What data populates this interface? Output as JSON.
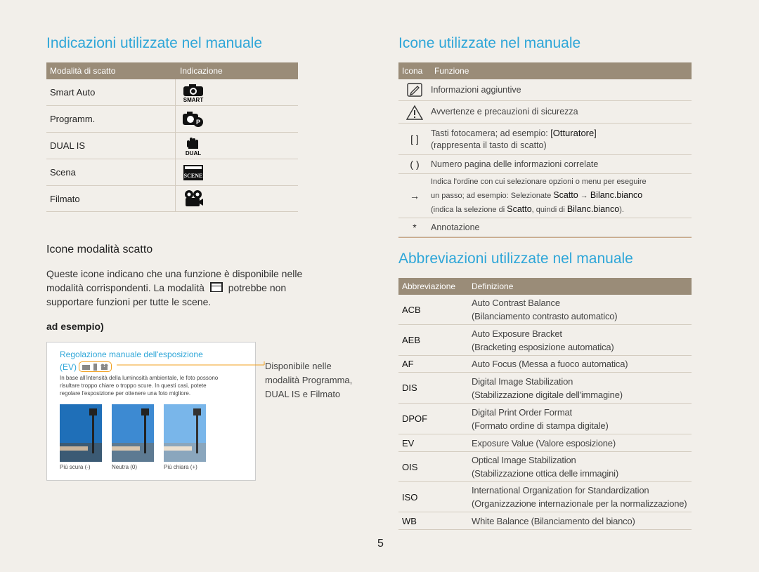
{
  "left": {
    "title": "Indicazioni utilizzate nel manuale",
    "table_headers": [
      "Modalità di scatto",
      "Indicazione"
    ],
    "modes": [
      {
        "label": "Smart Auto",
        "icon": "smart-auto-icon"
      },
      {
        "label": "Programm.",
        "icon": "program-mode-icon"
      },
      {
        "label": "DUAL IS",
        "icon": "dual-is-icon"
      },
      {
        "label": "Scena",
        "icon": "scene-mode-icon"
      },
      {
        "label": "Filmato",
        "icon": "movie-mode-icon"
      }
    ],
    "subtitle": "Icone modalità scatto",
    "para_line1": "Queste icone indicano che una funzione è disponibile nelle",
    "para_line2a": "modalità corrispondenti. La modalità",
    "para_line2b": "potrebbe non",
    "para_line3": "supportare funzioni per tutte le scene.",
    "example_label": "ad esempio)",
    "example": {
      "heading": "Regolazione manuale dell'esposizione",
      "ev": "(EV)",
      "desc_lines": [
        "In base all'intensità della luminosità ambientale, le foto possono",
        "risultare troppo chiare o troppo scure. In questi casi, potete",
        "regolare l'esposizione per ottenere una foto migliore."
      ],
      "captions": [
        "Più scura (-)",
        "Neutra (0)",
        "Più chiara (+)"
      ],
      "callout_lines": [
        "Disponibile nelle",
        "modalità Programma,",
        "DUAL IS e Filmato"
      ]
    }
  },
  "right": {
    "title1": "Icone utilizzate nel manuale",
    "icon_headers": [
      "Icona",
      "Funzione"
    ],
    "icons": [
      {
        "symbol": "",
        "icon": "note-icon",
        "text": "Informazioni aggiuntive"
      },
      {
        "symbol": "",
        "icon": "warning-icon",
        "text": "Avvertenze e precauzioni di sicurezza"
      },
      {
        "symbol": "[ ]",
        "text1a": "Tasti fotocamera; ad esempio: ",
        "text1b": "Otturatore",
        "text1c": "",
        "text2": "(rappresenta il tasto di scatto)"
      },
      {
        "symbol": "( )",
        "text": "Numero pagina delle informazioni correlate"
      },
      {
        "symbol": "→",
        "line1": "Indica l'ordine con cui selezionare opzioni o menu per eseguire",
        "line2a": "un passo; ad esempio: Selezionate ",
        "line2b": "Scatto",
        "line2c": " → ",
        "line2d": "Bilanc.bianco",
        "line3a": "(indica la selezione di ",
        "line3b": "Scatto",
        "line3c": ", quindi di ",
        "line3d": "Bilanc.bianco",
        "line3e": ")."
      },
      {
        "symbol": "*",
        "text": "Annotazione"
      }
    ],
    "title2": "Abbreviazioni utilizzate nel manuale",
    "abbr_headers": [
      "Abbreviazione",
      "Definizione"
    ],
    "abbrs": [
      {
        "abbr": "ACB",
        "def1": "Auto Contrast Balance",
        "def2": "(Bilanciamento contrasto automatico)"
      },
      {
        "abbr": "AEB",
        "def1": "Auto Exposure Bracket",
        "def2": "(Bracketing esposizione automatica)"
      },
      {
        "abbr": "AF",
        "def1": "Auto Focus (Messa a fuoco automatica)",
        "def2": ""
      },
      {
        "abbr": "DIS",
        "def1": "Digital Image Stabilization",
        "def2": "(Stabilizzazione digitale dell'immagine)"
      },
      {
        "abbr": "DPOF",
        "def1": "Digital Print Order Format",
        "def2": "(Formato ordine di stampa digitale)"
      },
      {
        "abbr": "EV",
        "def1": "Exposure Value (Valore esposizione)",
        "def2": ""
      },
      {
        "abbr": "OIS",
        "def1": "Optical Image Stabilization",
        "def2": "(Stabilizzazione ottica delle immagini)"
      },
      {
        "abbr": "ISO",
        "def1": "International Organization for Standardization",
        "def2": "(Organizzazione internazionale per la normalizzazione)"
      },
      {
        "abbr": "WB",
        "def1": "White Balance (Bilanciamento del bianco)",
        "def2": ""
      }
    ]
  },
  "page_number": "5",
  "colors": {
    "accent": "#2ea6d8",
    "table_header": "#9a8c78",
    "page_bg": "#f2efea",
    "callout": "#f0a020"
  }
}
